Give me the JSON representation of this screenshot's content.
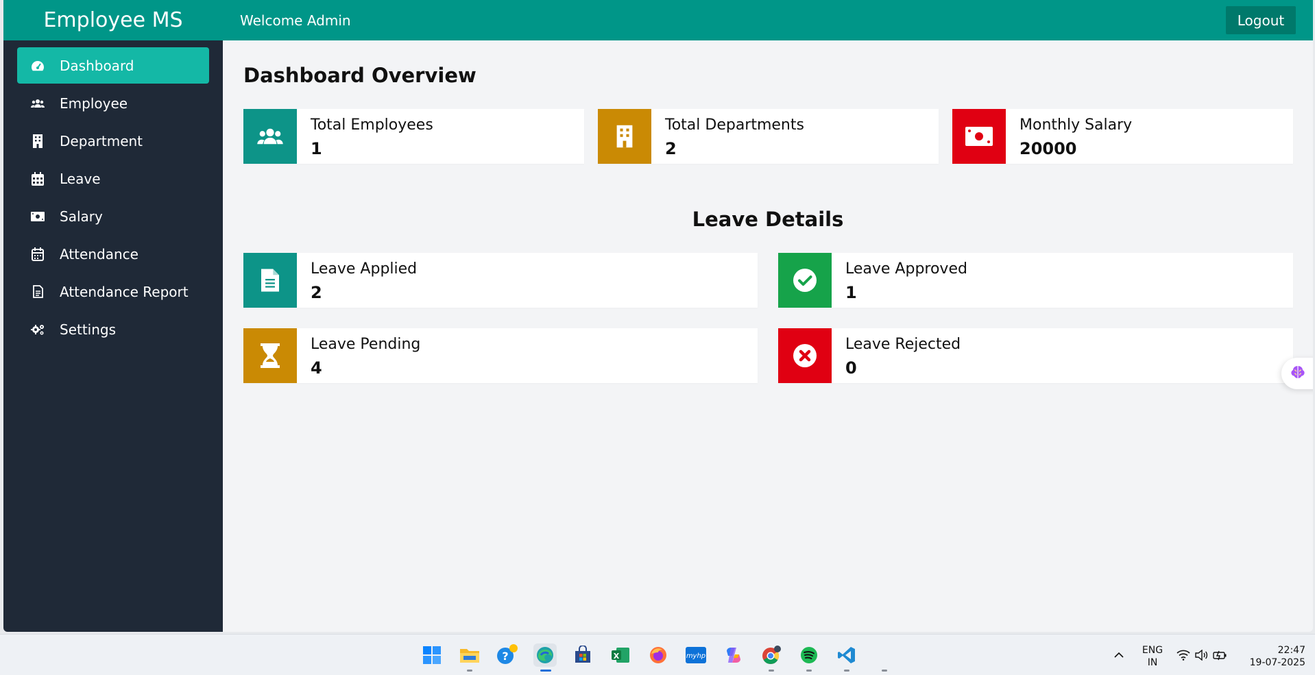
{
  "header": {
    "brand": "Employee MS",
    "welcome": "Welcome Admin",
    "logout_label": "Logout"
  },
  "sidebar": {
    "items": [
      {
        "label": "Dashboard",
        "icon": "dashboard-gauge-icon",
        "active": true
      },
      {
        "label": "Employee",
        "icon": "users-icon"
      },
      {
        "label": "Department",
        "icon": "building-icon"
      },
      {
        "label": "Leave",
        "icon": "calendar-icon"
      },
      {
        "label": "Salary",
        "icon": "money-bill-icon"
      },
      {
        "label": "Attendance",
        "icon": "calendar-check-icon"
      },
      {
        "label": "Attendance Report",
        "icon": "report-file-icon"
      },
      {
        "label": "Settings",
        "icon": "gears-icon"
      }
    ]
  },
  "overview": {
    "title": "Dashboard Overview",
    "cards": [
      {
        "label": "Total Employees",
        "value": "1",
        "icon": "users-icon",
        "color": "#0d9488"
      },
      {
        "label": "Total Departments",
        "value": "2",
        "icon": "building-icon",
        "color": "#ca8a04"
      },
      {
        "label": "Monthly Salary",
        "value": "20000",
        "icon": "money-bill-icon",
        "color": "#e00012"
      }
    ]
  },
  "leave": {
    "title": "Leave Details",
    "cards": [
      {
        "label": "Leave Applied",
        "value": "2",
        "icon": "file-text-icon",
        "color": "#0d9488"
      },
      {
        "label": "Leave Approved",
        "value": "1",
        "icon": "check-circle-icon",
        "color": "#16a34a"
      },
      {
        "label": "Leave Pending",
        "value": "4",
        "icon": "hourglass-icon",
        "color": "#ca8a04"
      },
      {
        "label": "Leave Rejected",
        "value": "0",
        "icon": "x-circle-icon",
        "color": "#e00012"
      }
    ]
  },
  "taskbar": {
    "lang_1": "ENG",
    "lang_2": "IN",
    "time": "22:47",
    "date": "19-07-2025",
    "apps": [
      "windows-start-icon",
      "file-explorer-icon",
      "help-icon",
      "edge-browser-icon",
      "microsoft-store-icon",
      "excel-icon",
      "firefox-icon",
      "myhp-icon",
      "copilot-icon",
      "chrome-icon",
      "spotify-icon",
      "vscode-icon"
    ]
  }
}
